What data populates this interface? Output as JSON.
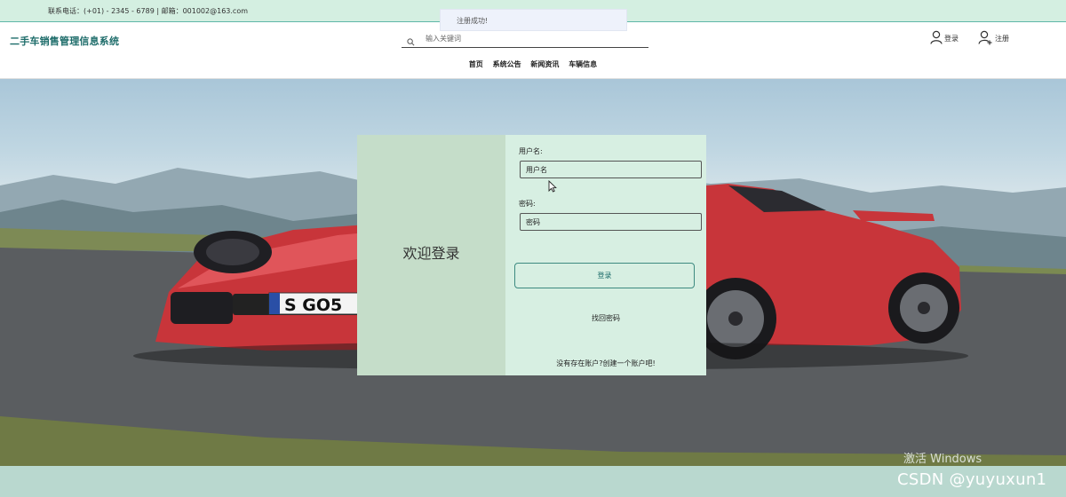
{
  "topbar": {
    "contact": "联系电话：(+01) - 2345 - 6789 | 邮箱：001002@163.com"
  },
  "toast": {
    "message": "注册成功!"
  },
  "header": {
    "brand": "二手车销售管理信息系统",
    "search_placeholder": "输入关键词",
    "login_label": "登录",
    "register_label": "注册"
  },
  "nav": {
    "items": [
      "首页",
      "系统公告",
      "新闻资讯",
      "车辆信息"
    ]
  },
  "login": {
    "welcome": "欢迎登录",
    "username_label": "用户名:",
    "username_placeholder": "用户名",
    "password_label": "密码:",
    "password_placeholder": "密码",
    "submit_label": "登录",
    "forgot_label": "找回密码",
    "register_hint": "没有存在账户?创建一个账户吧!"
  },
  "hero": {
    "plate_text": "S GO5"
  },
  "overlay": {
    "watermark": "激活 Windows",
    "credit": "CSDN @yuyuxun1"
  },
  "colors": {
    "brand": "#1d6c6a",
    "topbar_bg": "#d4efe1",
    "card_left": "#c5ddc9",
    "card_right": "#d7efe2",
    "footer_bg": "#b9d8cf"
  },
  "icons": {
    "search": "search-icon",
    "login": "user-icon",
    "register": "user-add-icon"
  }
}
